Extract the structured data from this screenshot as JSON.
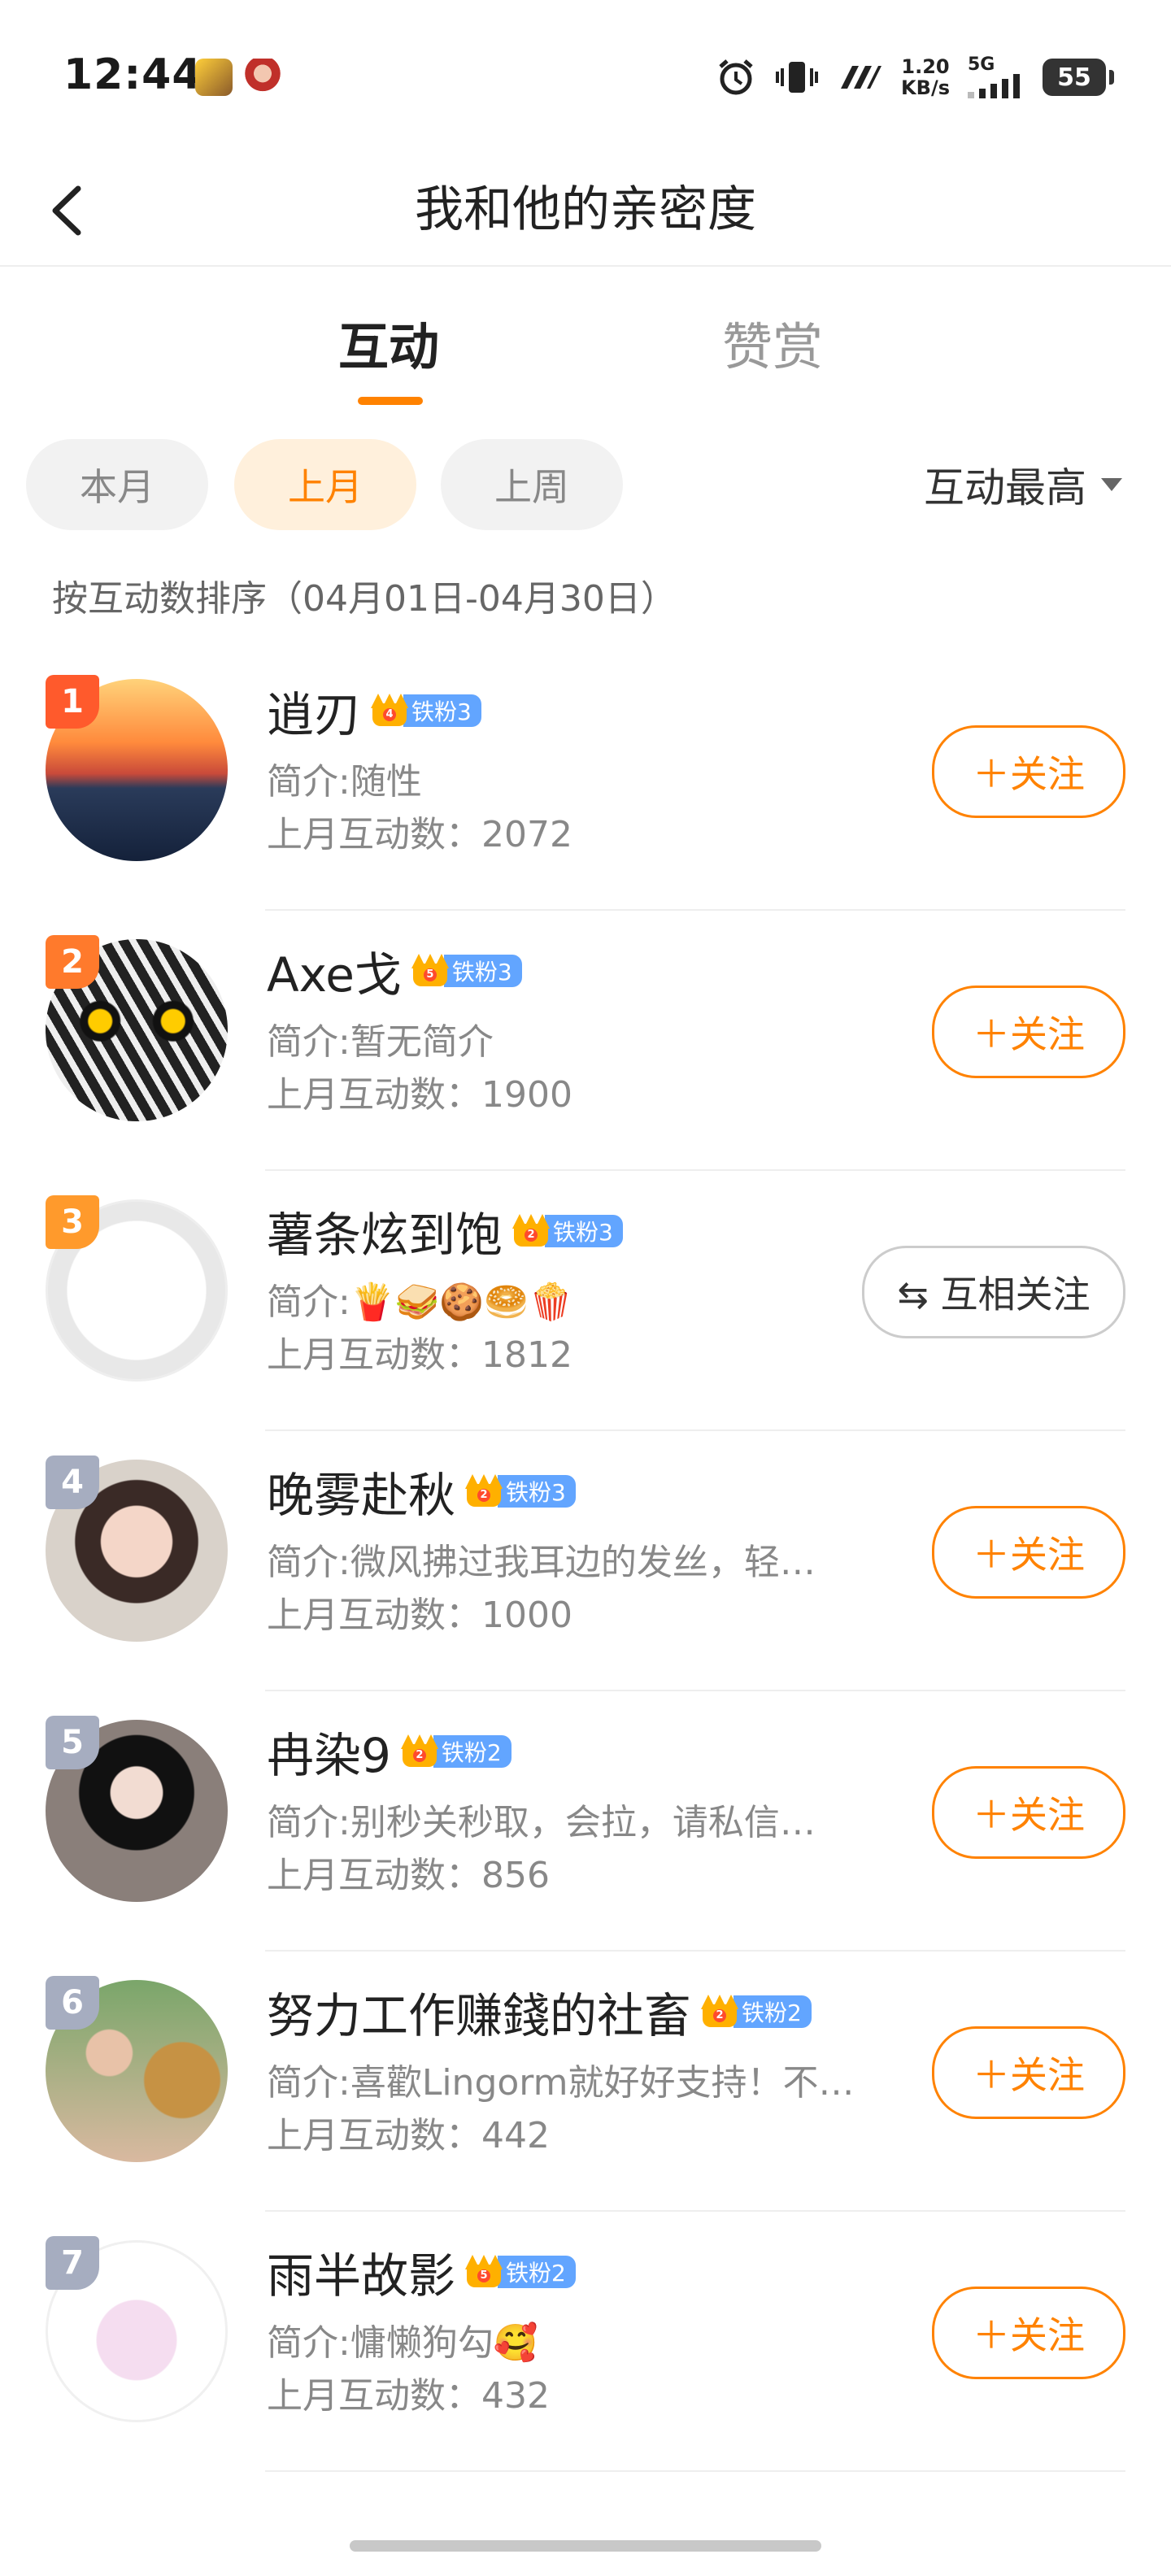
{
  "status_bar": {
    "time": "12:44",
    "net_speed_value": "1.20",
    "net_speed_unit": "KB/s",
    "network": "5G",
    "battery": "55",
    "icons": [
      "game-app-icon",
      "avatar-app-icon",
      "alarm-icon",
      "vibrate-icon",
      "nfc-icon",
      "signal-icon",
      "battery-icon"
    ]
  },
  "header": {
    "title": "我和他的亲密度",
    "back_icon": "chevron-left-icon"
  },
  "tabs": [
    {
      "label": "互动",
      "active": true
    },
    {
      "label": "赞赏",
      "active": false
    }
  ],
  "filters": {
    "chips": [
      {
        "label": "本月",
        "active": false
      },
      {
        "label": "上月",
        "active": true
      },
      {
        "label": "上周",
        "active": false
      }
    ],
    "sort_label": "互动最高"
  },
  "range_text": "按互动数排序（04月01日-04月30日）",
  "colors": {
    "accent": "#ff8200",
    "fan_badge": "#62a5ff",
    "rank_top": "#ff5a2c",
    "rank_other": "#a6adc0"
  },
  "users": [
    {
      "rank": "1",
      "name": "逍刃",
      "crown_level": "4",
      "fan": "铁粉3",
      "intro": "简介:随性",
      "count": "上月互动数：2072",
      "button": "＋关注"
    },
    {
      "rank": "2",
      "name": "Axe戈",
      "crown_level": "5",
      "fan": "铁粉3",
      "intro": "简介:暂无简介",
      "count": "上月互动数：1900",
      "button": "＋关注"
    },
    {
      "rank": "3",
      "name": "薯条炫到饱",
      "crown_level": "2",
      "fan": "铁粉3",
      "intro": "简介:🍟🥪🍪🥯🍿",
      "count": "上月互动数：1812",
      "button": "⇆ 互相关注"
    },
    {
      "rank": "4",
      "name": "晚雾赴秋",
      "crown_level": "2",
      "fan": "铁粉3",
      "intro": "简介:微风拂过我耳边的发丝，轻…",
      "count": "上月互动数：1000",
      "button": "＋关注"
    },
    {
      "rank": "5",
      "name": "冉染9",
      "crown_level": "2",
      "fan": "铁粉2",
      "intro": "简介:别秒关秒取，会拉，请私信…",
      "count": "上月互动数：856",
      "button": "＋关注"
    },
    {
      "rank": "6",
      "name": "努力工作赚錢的社畜",
      "crown_level": "2",
      "fan": "铁粉2",
      "intro": "简介:喜歡Lingorm就好好支持！不…",
      "count": "上月互动数：442",
      "button": "＋关注"
    },
    {
      "rank": "7",
      "name": "雨半故影",
      "crown_level": "5",
      "fan": "铁粉2",
      "intro": "简介:慵懒狗勾🥰",
      "count": "上月互动数：432",
      "button": "＋关注"
    }
  ]
}
